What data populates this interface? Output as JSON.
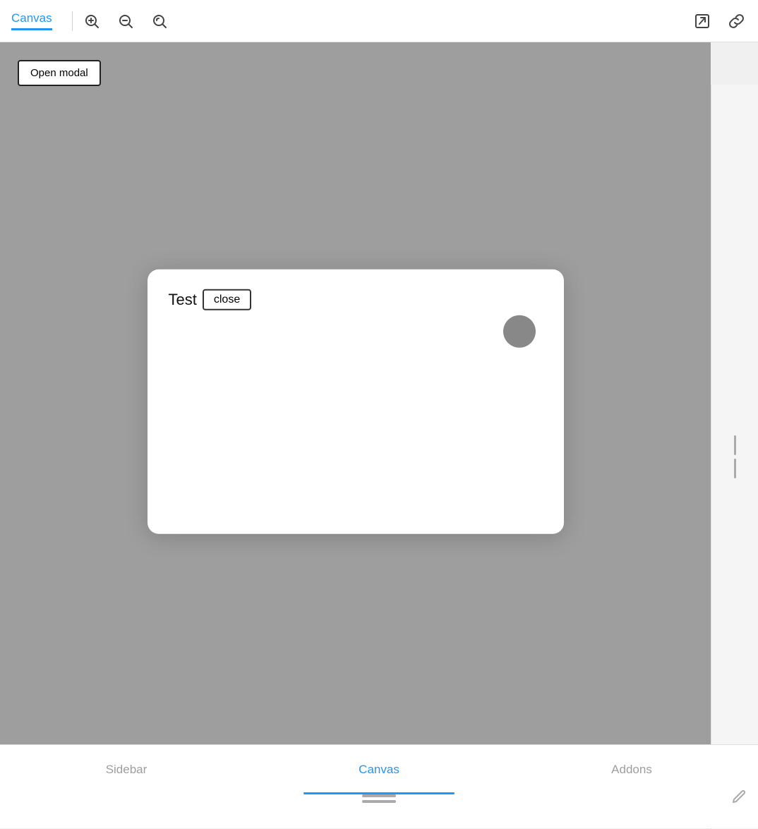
{
  "toolbar": {
    "tab_label": "Canvas",
    "divider": true,
    "zoom_in_icon": "+",
    "zoom_out_icon": "−",
    "reset_icon": "↺",
    "export_icon": "⬡",
    "link_icon": "⚭"
  },
  "canvas": {
    "open_modal_button": "Open modal",
    "modal": {
      "text_prefix": "Test",
      "close_button_label": "close"
    }
  },
  "bottom_tabs": [
    {
      "label": "Sidebar",
      "active": false
    },
    {
      "label": "Canvas",
      "active": true
    },
    {
      "label": "Addons",
      "active": false
    }
  ]
}
